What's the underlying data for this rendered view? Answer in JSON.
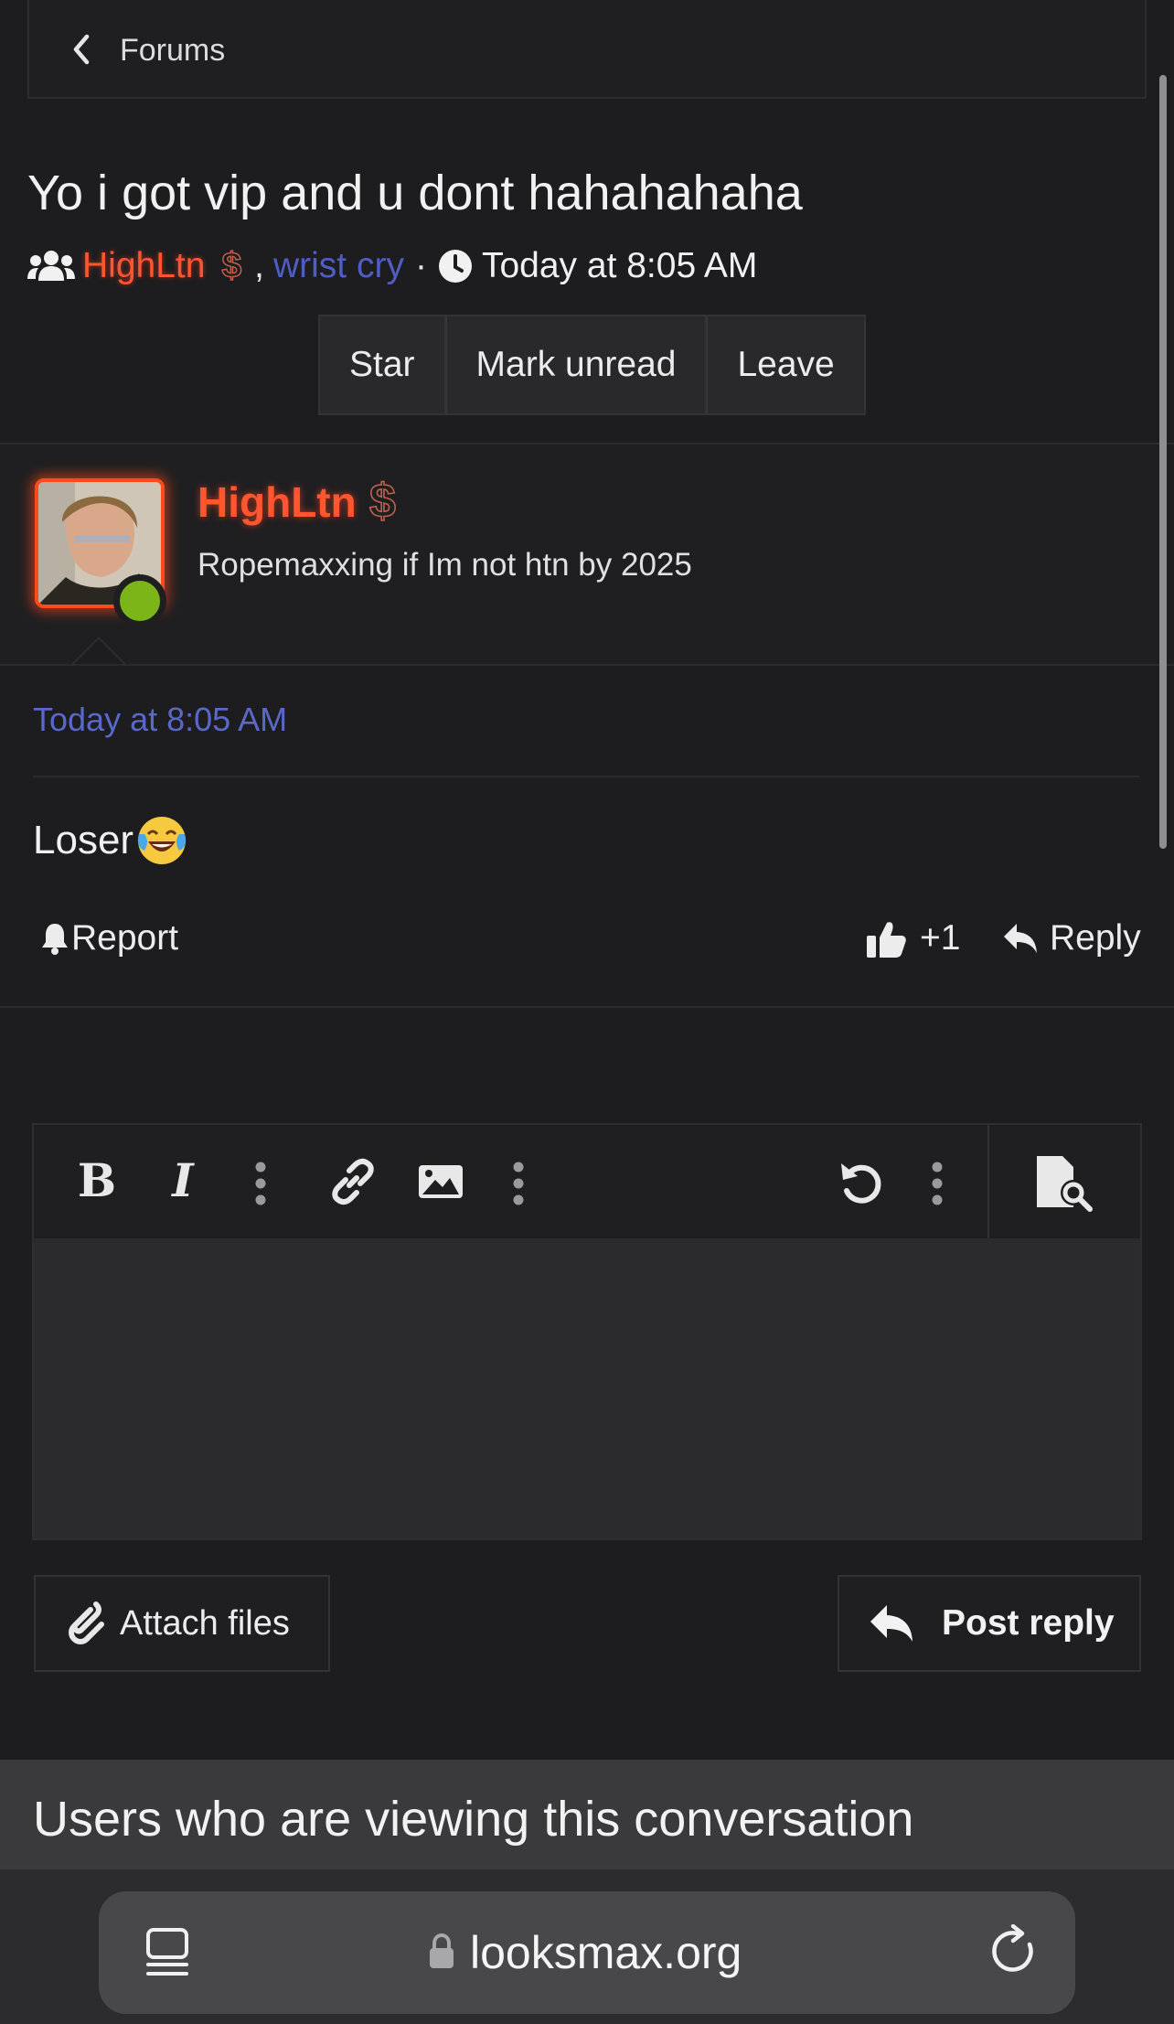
{
  "breadcrumb": {
    "label": "Forums"
  },
  "thread": {
    "title": "Yo i got vip and u dont hahahahaha",
    "participants": [
      "HighLtn",
      "wrist cry"
    ],
    "separator": ",",
    "dollar_badge": "$",
    "meta_dot": "·",
    "started": "Today at 8:05 AM"
  },
  "actions": {
    "star": "Star",
    "mark_unread": "Mark unread",
    "leave": "Leave"
  },
  "message": {
    "author": "HighLtn",
    "author_badge": "$",
    "user_title": "Ropemaxxing if Im not htn by 2025",
    "timestamp": "Today at 8:05 AM",
    "body": "Loser",
    "report_label": "Report",
    "like_count": "+1",
    "reply_label": "Reply"
  },
  "editor": {
    "attach_label": "Attach files",
    "post_reply_label": "Post reply"
  },
  "viewers": {
    "title": "Users who are viewing this conversation"
  },
  "browser": {
    "url": "looksmax.org"
  },
  "colors": {
    "accent_user": "#ff5630",
    "link": "#5a68c9",
    "online": "#7cb518"
  }
}
